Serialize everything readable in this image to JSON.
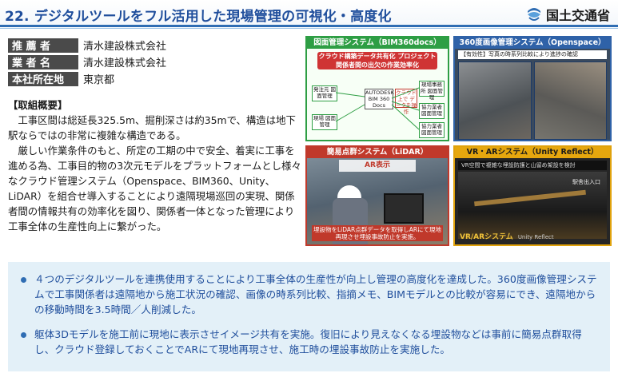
{
  "header": {
    "title": "22. デジタルツールをフル活用した現場管理の可視化・高度化",
    "ministry": "国土交通省"
  },
  "info": [
    {
      "label": "推 薦 者",
      "value": "清水建設株式会社"
    },
    {
      "label": "業 者 名",
      "value": "清水建設株式会社"
    },
    {
      "label": "本社所在地",
      "value": "東京都"
    }
  ],
  "overview": {
    "heading": "【取組概要】",
    "p1": "工事区間は総延長325.5m、掘削深さは約35mで、構造は地下駅ならではの非常に複雑な構造である。",
    "p2": "厳しい作業条件のもと、所定の工期の中で安全、着実に工事を進める為、工事目的物の3次元モデルをプラットフォームとし様々なクラウド管理システム（Openspace、BIM360、Unity、LiDAR）を組合せ導入することにより遠隔現場巡回の実現、関係者間の情報共有の効率化を図り、関係者一体となった管理により工事全体の生産性向上に繋がった。"
  },
  "panels": {
    "p1": {
      "title": "図面管理システム（BIM360docs）",
      "banner": "クラウド構築データ共有化 プロジェクト関係者間の出欠の作業効率化",
      "center": "AUTODESK BIM 360 Docs",
      "nodes": [
        "発注元 図面管理",
        "現場事務所 図面管理",
        "協力業者 図面管理",
        "現場 図面管理",
        "協力業者 図面管理",
        "クラウド上で データを操作"
      ]
    },
    "p2": {
      "title": "360度画像管理システム（Openspace）",
      "strip": "【有効性】写真の時系列比較により進捗の確認"
    },
    "p3": {
      "title": "簡易点群システム（LiDAR）",
      "label": "AR表示",
      "caption": "埋設物をLiDAR点群データを取得しARにて現地再現させ埋設事故防止を実施。"
    },
    "p4": {
      "title": "VR・ARシステム（Unity Reflect）",
      "strip": "VR空間で複雑な埋設防護と山留め架設を検討",
      "exit": "駅舎出入口",
      "caption": "VR/ARシステム",
      "sub": "Unity Reflect"
    }
  },
  "summary": [
    "４つのデジタルツールを連携使用することにより工事全体の生産性が向上し管理の高度化を達成した。360度画像管理システムで工事関係者は遠隔地から施工状況の確認、画像の時系列比較、指摘メモ、BIMモデルとの比較が容易にでき、遠隔地からの移動時間を3.5時間／人削減した。",
    "躯体3Dモデルを施工前に現地に表示させイメージ共有を実施。復旧により見えなくなる埋設物などは事前に簡易点群取得し、クラウド登録しておくことでARにて現地再現させ、施工時の埋設事故防止を実施した。"
  ],
  "colors": {
    "accent": "#2f6db3",
    "title": "#1f4e9c",
    "summary_bg": "#e3f0f8"
  }
}
